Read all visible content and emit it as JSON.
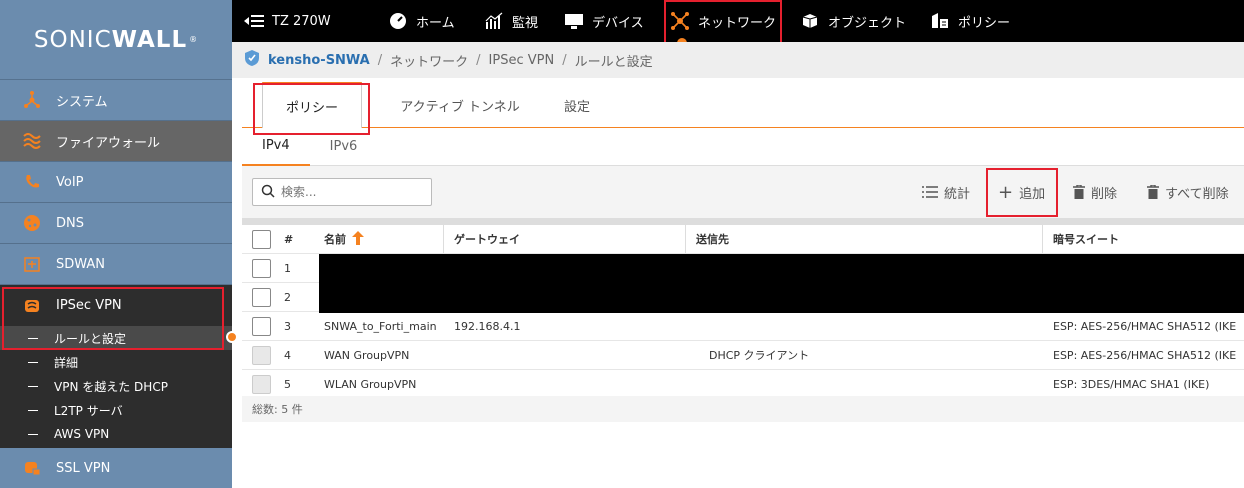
{
  "logo": {
    "left": "SONIC",
    "right": "WALL",
    "mark": "®"
  },
  "sidebar": {
    "items": [
      {
        "label": "システム",
        "icon": "network-icon"
      },
      {
        "label": "ファイアウォール",
        "icon": "firewall-icon"
      },
      {
        "label": "VoIP",
        "icon": "voip-icon"
      },
      {
        "label": "DNS",
        "icon": "dns-icon"
      },
      {
        "label": "SDWAN",
        "icon": "sdwan-icon"
      },
      {
        "label": "IPSec VPN",
        "icon": "ipsec-icon"
      }
    ],
    "subitems": [
      {
        "label": "ルールと設定"
      },
      {
        "label": "詳細"
      },
      {
        "label": "VPN を越えた DHCP"
      },
      {
        "label": "L2TP サーバ"
      },
      {
        "label": "AWS VPN"
      }
    ],
    "next_item": {
      "label": "SSL VPN",
      "icon": "sslvpn-icon"
    }
  },
  "topbar": {
    "device": "TZ 270W",
    "items": [
      {
        "label": "ホーム",
        "icon": "home-icon"
      },
      {
        "label": "監視",
        "icon": "monitor-icon"
      },
      {
        "label": "デバイス",
        "icon": "device-icon"
      },
      {
        "label": "ネットワーク",
        "icon": "network-icon"
      },
      {
        "label": "オブジェクト",
        "icon": "object-icon"
      },
      {
        "label": "ポリシー",
        "icon": "policy-icon"
      }
    ]
  },
  "breadcrumb": {
    "device": "kensho-SNWA",
    "parts": [
      "ネットワーク",
      "IPSec VPN",
      "ルールと設定"
    ],
    "sep": "/"
  },
  "tabs": [
    "ポリシー",
    "アクティブ トンネル",
    "設定"
  ],
  "subtabs": [
    "IPv4",
    "IPv6"
  ],
  "toolbar": {
    "search_placeholder": "検索...",
    "stats": "統計",
    "add": "追加",
    "delete": "削除",
    "delete_all": "すべて削除"
  },
  "table": {
    "headers": {
      "num": "#",
      "name": "名前",
      "gateway": "ゲートウェイ",
      "destination": "送信先",
      "cipher": "暗号スイート"
    },
    "rows": [
      {
        "num": "1",
        "name": "",
        "gateway": "",
        "destination": "",
        "cipher": "",
        "disabled": false
      },
      {
        "num": "2",
        "name": "",
        "gateway": "",
        "destination": "",
        "cipher": "",
        "disabled": false
      },
      {
        "num": "3",
        "name": "SNWA_to_Forti_main",
        "gateway": "192.168.4.1",
        "destination": "",
        "cipher": "ESP: AES-256/HMAC SHA512 (IKE",
        "disabled": false
      },
      {
        "num": "4",
        "name": "WAN GroupVPN",
        "gateway": "",
        "destination": "DHCP クライアント",
        "cipher": "ESP: AES-256/HMAC SHA512 (IKE",
        "disabled": true
      },
      {
        "num": "5",
        "name": "WLAN GroupVPN",
        "gateway": "",
        "destination": "",
        "cipher": "ESP: 3DES/HMAC SHA1 (IKE)",
        "disabled": true
      }
    ],
    "total": "総数: 5 件"
  },
  "colors": {
    "accent": "#f58220",
    "sidebar": "#6b8cae",
    "highlight": "#e5202e",
    "link": "#2a6fb0"
  }
}
